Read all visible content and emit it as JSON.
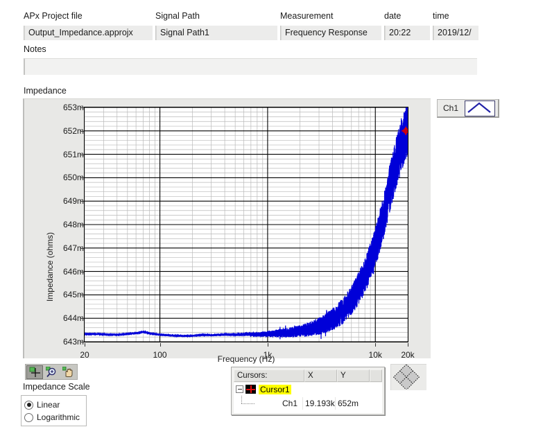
{
  "header": {
    "fields": [
      {
        "label": "APx Project file",
        "value": "Output_Impedance.approjx"
      },
      {
        "label": "Signal Path",
        "value": "Signal Path1"
      },
      {
        "label": "Measurement",
        "value": "Frequency Response"
      },
      {
        "label": "date",
        "value": "20:22"
      },
      {
        "label": "time",
        "value": "2019/12/"
      }
    ],
    "notes_label": "Notes",
    "notes_value": ""
  },
  "graph": {
    "title": "Impedance"
  },
  "legend": {
    "label": "Ch1",
    "icon": "peak-line-icon",
    "color": "#0000d8"
  },
  "toolbar": {
    "buttons": [
      {
        "name": "cursor-tool",
        "icon": "crosshair-icon",
        "pressed": true
      },
      {
        "name": "zoom-tool",
        "icon": "magnifier-plus-icon",
        "pressed": false
      },
      {
        "name": "pan-tool",
        "icon": "hand-icon",
        "pressed": false
      }
    ]
  },
  "scale": {
    "title": "Impedance Scale",
    "options": [
      {
        "label": "Linear",
        "selected": true
      },
      {
        "label": "Logarithmic",
        "selected": false
      }
    ]
  },
  "cursors": {
    "columns": [
      "Cursors:",
      "X",
      "Y"
    ],
    "root": {
      "label": "Cursor1",
      "icon": "cursor-crosshair-icon",
      "expanded": true
    },
    "rows": [
      {
        "name": "Ch1",
        "x": "19.193k",
        "y": "652m"
      }
    ]
  },
  "grip": {
    "icon": "resize-diamond-icon"
  },
  "chart_data": {
    "type": "line",
    "title": "Impedance",
    "xlabel": "Frequency (Hz)",
    "ylabel": "Impedance (ohms)",
    "xscale": "log",
    "yscale": "linear",
    "xlim": [
      20,
      20000
    ],
    "ylim": [
      0.643,
      0.653
    ],
    "xticks": [
      {
        "value": 20,
        "label": "20"
      },
      {
        "value": 100,
        "label": "100"
      },
      {
        "value": 1000,
        "label": "1k"
      },
      {
        "value": 10000,
        "label": "10k"
      },
      {
        "value": 20000,
        "label": "20k"
      }
    ],
    "yticks": [
      {
        "value": 0.643,
        "label": "643m"
      },
      {
        "value": 0.644,
        "label": "644m"
      },
      {
        "value": 0.645,
        "label": "645m"
      },
      {
        "value": 0.646,
        "label": "646m"
      },
      {
        "value": 0.647,
        "label": "647m"
      },
      {
        "value": 0.648,
        "label": "648m"
      },
      {
        "value": 0.649,
        "label": "649m"
      },
      {
        "value": 0.65,
        "label": "650m"
      },
      {
        "value": 0.651,
        "label": "651m"
      },
      {
        "value": 0.652,
        "label": "652m"
      },
      {
        "value": 0.653,
        "label": "653m"
      }
    ],
    "grid": {
      "major": true,
      "minor": true
    },
    "legend_position": "outside-top-right",
    "series": [
      {
        "name": "Ch1",
        "color": "#0000d8",
        "noise_band": true,
        "points": [
          {
            "f": 20,
            "z": 0.64333
          },
          {
            "f": 25,
            "z": 0.64333
          },
          {
            "f": 32,
            "z": 0.64331
          },
          {
            "f": 40,
            "z": 0.6433
          },
          {
            "f": 50,
            "z": 0.64333
          },
          {
            "f": 63,
            "z": 0.64338
          },
          {
            "f": 70,
            "z": 0.64342
          },
          {
            "f": 80,
            "z": 0.64336
          },
          {
            "f": 100,
            "z": 0.6433
          },
          {
            "f": 125,
            "z": 0.64327
          },
          {
            "f": 160,
            "z": 0.64325
          },
          {
            "f": 200,
            "z": 0.64325
          },
          {
            "f": 250,
            "z": 0.64329
          },
          {
            "f": 315,
            "z": 0.64328
          },
          {
            "f": 400,
            "z": 0.64331
          },
          {
            "f": 500,
            "z": 0.6433
          },
          {
            "f": 630,
            "z": 0.64332
          },
          {
            "f": 800,
            "z": 0.64331
          },
          {
            "f": 1000,
            "z": 0.64333
          },
          {
            "f": 1250,
            "z": 0.64336
          },
          {
            "f": 1600,
            "z": 0.6434
          },
          {
            "f": 2000,
            "z": 0.64345
          },
          {
            "f": 2500,
            "z": 0.64355
          },
          {
            "f": 3150,
            "z": 0.6437
          },
          {
            "f": 4000,
            "z": 0.64395
          },
          {
            "f": 5000,
            "z": 0.6443
          },
          {
            "f": 6300,
            "z": 0.6449
          },
          {
            "f": 8000,
            "z": 0.6458
          },
          {
            "f": 10000,
            "z": 0.647
          },
          {
            "f": 12500,
            "z": 0.6487
          },
          {
            "f": 14000,
            "z": 0.6498
          },
          {
            "f": 16000,
            "z": 0.6508
          },
          {
            "f": 18000,
            "z": 0.6516
          },
          {
            "f": 19193,
            "z": 0.652
          },
          {
            "f": 20000,
            "z": 0.65215
          }
        ]
      }
    ],
    "cursor_marker": {
      "name": "Cursor1",
      "f": 19193,
      "z": 0.652,
      "color": "#e00000"
    }
  }
}
